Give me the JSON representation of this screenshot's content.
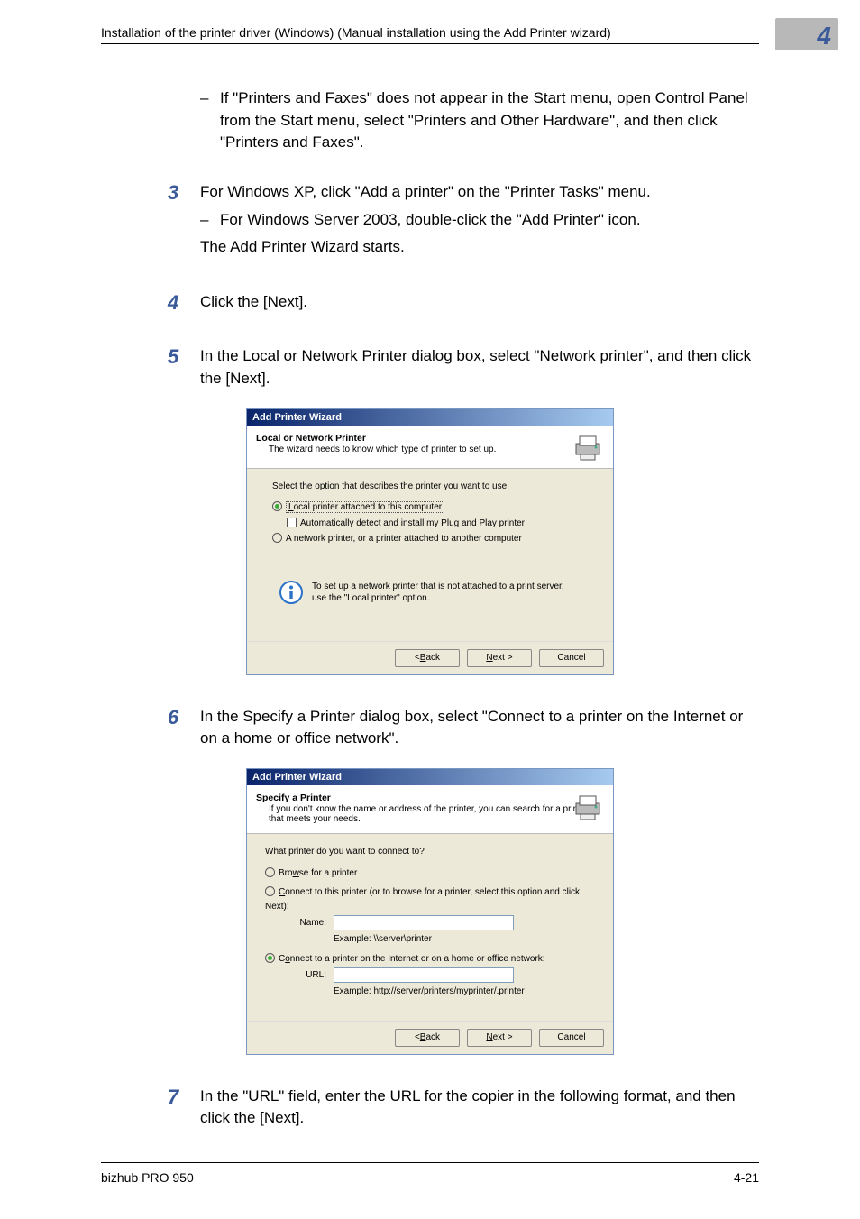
{
  "header": {
    "title": "Installation of the printer driver (Windows) (Manual installation using the Add Printer wizard)",
    "chapter_number": "4"
  },
  "intro_bullet": "If \"Printers and Faxes\" does not appear in the Start menu, open Control Panel from the Start menu, select \"Printers and Other Hardware\", and then click \"Printers and Faxes\".",
  "steps": {
    "s3": {
      "num": "3",
      "text": "For Windows XP, click \"Add a printer\" on the \"Printer Tasks\" menu.",
      "sub": "For Windows Server 2003, double-click the \"Add Printer\" icon.",
      "line2": "The Add Printer Wizard starts."
    },
    "s4": {
      "num": "4",
      "text": "Click the [Next]."
    },
    "s5": {
      "num": "5",
      "text": "In the Local or Network Printer dialog box, select \"Network printer\", and then click the [Next]."
    },
    "s6": {
      "num": "6",
      "text": "In the Specify a Printer dialog box, select \"Connect to a printer on the Internet or on a home or office network\"."
    },
    "s7": {
      "num": "7",
      "text": "In the \"URL\" field, enter the URL for the copier in the following format, and then click the [Next]."
    }
  },
  "wizard1": {
    "title": "Add Printer Wizard",
    "head_title": "Local or Network Printer",
    "head_sub": "The wizard needs to know which type of printer to set up.",
    "prompt": "Select the option that describes the printer you want to use:",
    "opt_local_prefix": "L",
    "opt_local_rest": "ocal printer attached to this computer",
    "opt_local_focus_prefix": "L",
    "chk_auto_prefix": "A",
    "chk_auto_rest": "utomatically detect and install my Plug and Play printer",
    "opt_network": "A network printer, or a printer attached to another computer",
    "info_l1": "To set up a network printer that is not attached to a print server,",
    "info_l2": "use the \"Local printer\" option.",
    "back": "Back",
    "back_u": "B",
    "next": "ext >",
    "next_u": "N",
    "cancel": "Cancel"
  },
  "wizard2": {
    "title": "Add Printer Wizard",
    "head_title": "Specify a Printer",
    "head_sub": "If you don't know the name or address of the printer, you can search for a printer that meets your needs.",
    "prompt": "What printer do you want to connect to?",
    "opt_browse_prefix": "Bro",
    "opt_browse_u": "w",
    "opt_browse_rest": "se for a printer",
    "opt_connect_name_prefix": "",
    "opt_connect_name_u": "C",
    "opt_connect_name_rest": "onnect to this printer (or to browse for a printer, select this option and click Next):",
    "name_label": "Name:",
    "name_value": "",
    "example_name": "Example: \\\\server\\printer",
    "opt_internet_prefix": "C",
    "opt_internet_u": "o",
    "opt_internet_rest": "nnect to a printer on the Internet or on a home or office network:",
    "url_label": "URL:",
    "url_value": "",
    "example_url": "Example: http://server/printers/myprinter/.printer",
    "back": "Back",
    "back_u": "B",
    "next": "ext >",
    "next_u": "N",
    "cancel": "Cancel"
  },
  "footer": {
    "product": "bizhub PRO 950",
    "page_no": "4-21"
  }
}
